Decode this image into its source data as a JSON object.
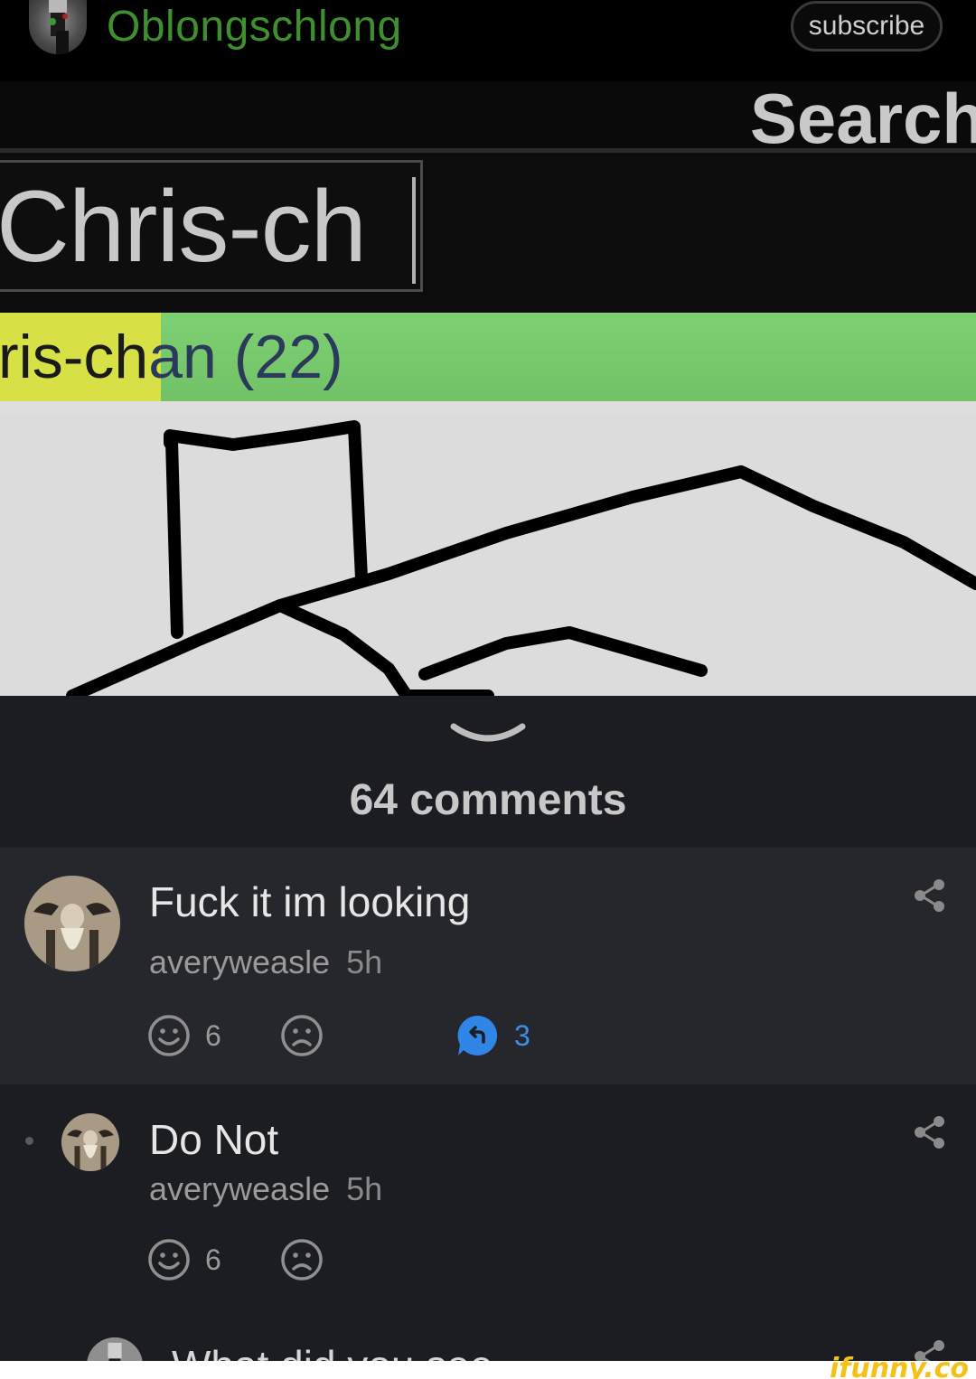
{
  "header": {
    "channel_name": "Oblongschlong",
    "subscribe_label": "subscribe",
    "channel_color": "#3f8f2e"
  },
  "image": {
    "search_label": "Search",
    "input_text": "Chris-ch",
    "result_text_head": "ris-ch",
    "result_text_tail": "an (22)",
    "result_highlight_color": "#d7e044",
    "result_row_color": "#7fcf73"
  },
  "comments": {
    "count_label": "64 comments",
    "items": [
      {
        "text": "Fuck it im looking",
        "author": "averyweasle",
        "time": "5h",
        "likes": "6",
        "replies": "3"
      },
      {
        "text": "Do Not",
        "author": "averyweasle",
        "time": "5h",
        "likes": "6"
      },
      {
        "text": "What did you see"
      }
    ]
  },
  "watermark": "ifunny.co",
  "icons": [
    "chevron-down-icon",
    "share-icon",
    "smile-icon",
    "frown-icon",
    "reply-icon"
  ]
}
